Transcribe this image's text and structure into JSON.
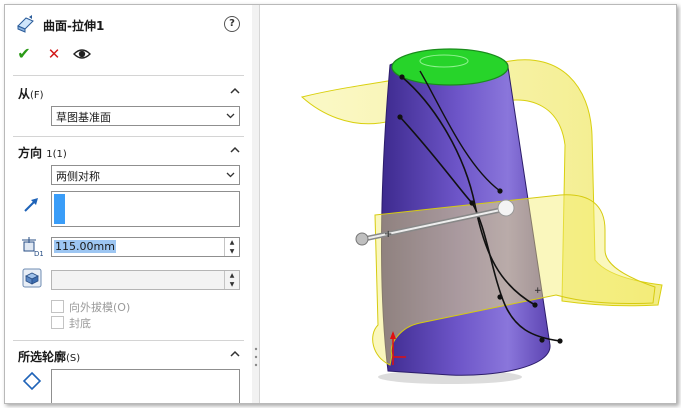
{
  "panel": {
    "title": "曲面-拉伸1",
    "help_label": "?",
    "actions": {
      "ok_glyph": "✔",
      "cancel_glyph": "✕"
    },
    "from": {
      "label": "从",
      "key": "(F)",
      "value": "草图基准面"
    },
    "direction1": {
      "label": "方向",
      "key": "1(1)",
      "end_condition": "两侧对称",
      "depth_value": "115.00mm",
      "draft_outward_label": "向外拔模(O)",
      "cap_end_label": "封底"
    },
    "selected_contours": {
      "label": "所选轮廓",
      "key": "(S)"
    }
  },
  "colors": {
    "ok": "#2b9a18",
    "cancel": "#d21a1a",
    "surface_yellow": "#f4f06a",
    "body_purple": "#6a4fc2",
    "face_green": "#27d42a",
    "selection_blue": "#3a9df8"
  },
  "icons": [
    "extrude-surface-icon",
    "help-icon",
    "ok-icon",
    "cancel-icon",
    "eye-preview-icon",
    "chevron-up-icon",
    "dropdown-arrow-icon",
    "direction-arrow-icon",
    "depth-icon",
    "draft-icon",
    "contour-icon",
    "splitter-grip-icon"
  ]
}
